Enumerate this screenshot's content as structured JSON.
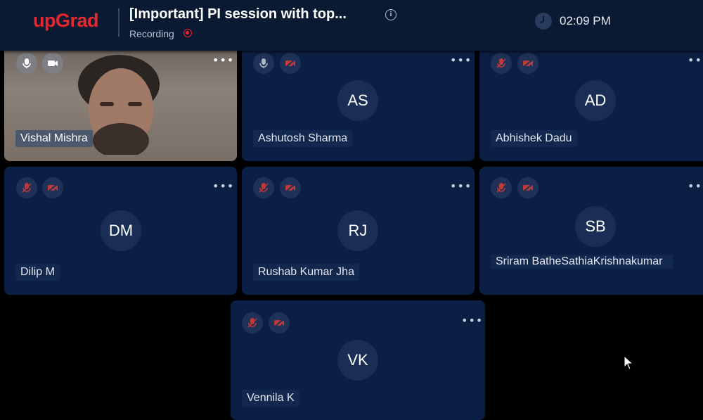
{
  "header": {
    "logo": "upGrad",
    "title": "[Important] PI session with top...",
    "recording_label": "Recording",
    "time": "02:09 PM",
    "brand_color": "#e8262d"
  },
  "participants": [
    {
      "name": "Vishal Mishra",
      "initials": "",
      "video": true,
      "mic": "on",
      "cam": "on"
    },
    {
      "name": "Ashutosh Sharma",
      "initials": "AS",
      "mic": "on",
      "cam": "off"
    },
    {
      "name": "Abhishek Dadu",
      "initials": "AD",
      "mic": "off",
      "cam": "off"
    },
    {
      "name": "Dilip M",
      "initials": "DM",
      "mic": "off",
      "cam": "off"
    },
    {
      "name": "Rushab Kumar Jha",
      "initials": "RJ",
      "mic": "off",
      "cam": "off"
    },
    {
      "name": "Sriram BatheSathiaKrishnakumar",
      "initials": "SB",
      "mic": "off",
      "cam": "off"
    },
    {
      "name": "Vennila K",
      "initials": "VK",
      "mic": "off",
      "cam": "off"
    }
  ],
  "icons": {
    "more": "more-options-icon",
    "mic": "microphone-icon",
    "mic_off": "microphone-muted-icon",
    "cam": "camera-icon",
    "cam_off": "camera-off-icon",
    "clock": "clock-icon",
    "info": "info-icon"
  },
  "colors": {
    "tile_bg": "#0b1e44",
    "muted_red": "#c0393b",
    "header_bg": "#0b1a33"
  }
}
